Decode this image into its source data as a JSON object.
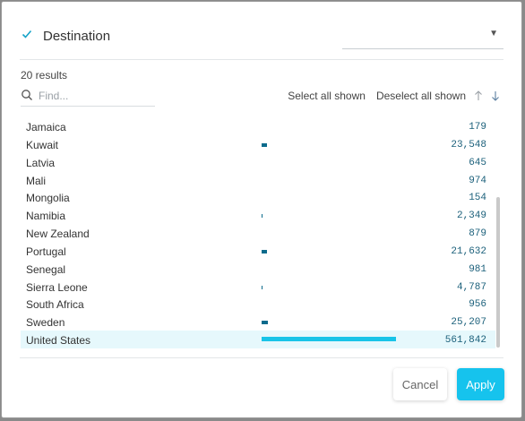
{
  "header": {
    "title": "Destination",
    "selected_value": ""
  },
  "results_count": "20 results",
  "search": {
    "placeholder": "Find..."
  },
  "actions": {
    "select_all": "Select all shown",
    "deselect_all": "Deselect all shown"
  },
  "items": [
    {
      "name": "Jamaica",
      "value": "179",
      "amount": 179,
      "selected": false
    },
    {
      "name": "Kuwait",
      "value": "23,548",
      "amount": 23548,
      "selected": false
    },
    {
      "name": "Latvia",
      "value": "645",
      "amount": 645,
      "selected": false
    },
    {
      "name": "Mali",
      "value": "974",
      "amount": 974,
      "selected": false
    },
    {
      "name": "Mongolia",
      "value": "154",
      "amount": 154,
      "selected": false
    },
    {
      "name": "Namibia",
      "value": "2,349",
      "amount": 2349,
      "selected": false
    },
    {
      "name": "New Zealand",
      "value": "879",
      "amount": 879,
      "selected": false
    },
    {
      "name": "Portugal",
      "value": "21,632",
      "amount": 21632,
      "selected": false
    },
    {
      "name": "Senegal",
      "value": "981",
      "amount": 981,
      "selected": false
    },
    {
      "name": "Sierra Leone",
      "value": "4,787",
      "amount": 4787,
      "selected": false
    },
    {
      "name": "South Africa",
      "value": "956",
      "amount": 956,
      "selected": false
    },
    {
      "name": "Sweden",
      "value": "25,207",
      "amount": 25207,
      "selected": false
    },
    {
      "name": "United States",
      "value": "561,842",
      "amount": 561842,
      "selected": true
    }
  ],
  "buttons": {
    "cancel": "Cancel",
    "apply": "Apply"
  },
  "colors": {
    "accent": "#16c3ed",
    "bar": "#0b6b8c",
    "selected_row": "#e6f8fc"
  }
}
